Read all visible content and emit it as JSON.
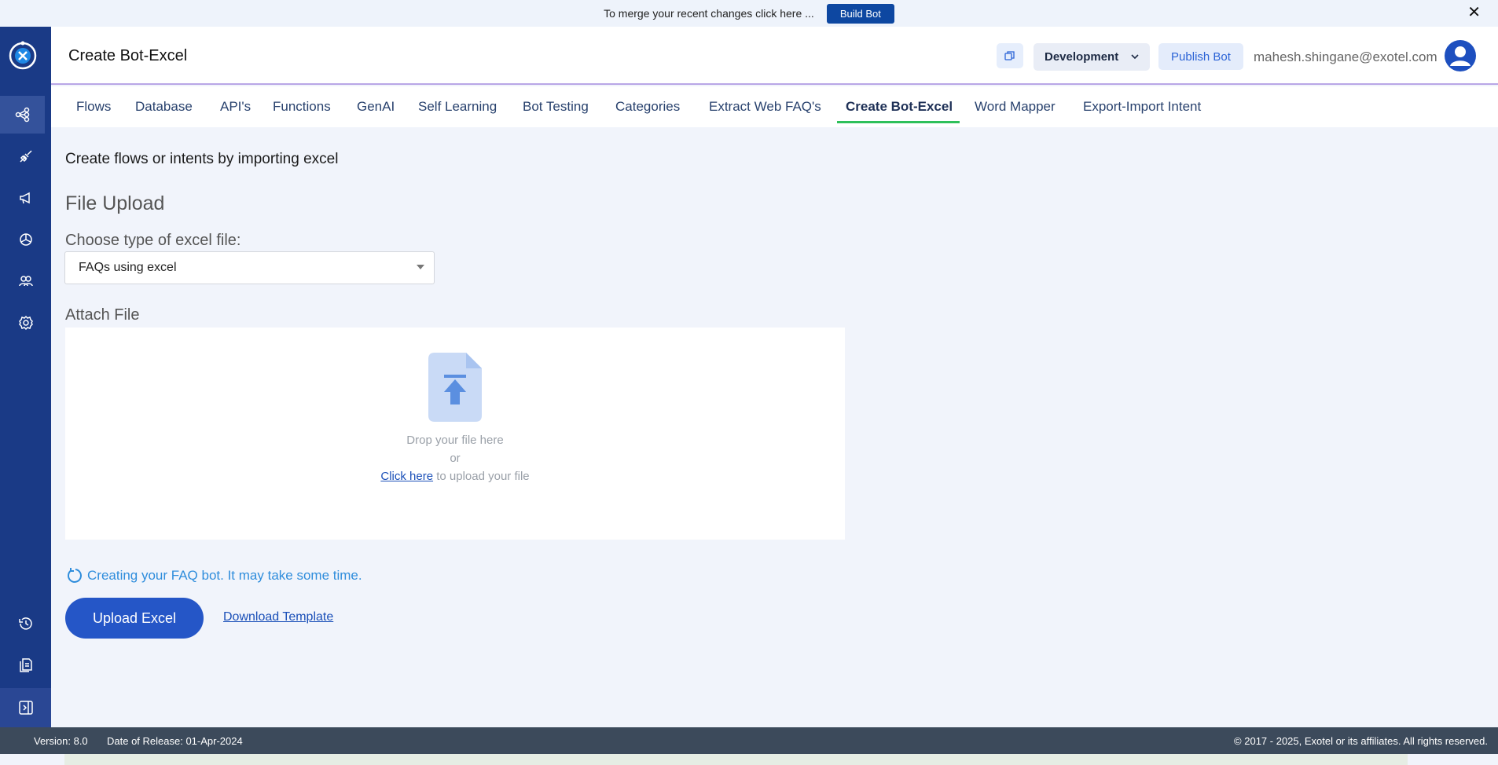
{
  "banner": {
    "message": "To merge your recent changes click here ...",
    "button_label": "Build Bot",
    "close_glyph": "✕"
  },
  "sidebar": {
    "items": [
      {
        "icon": "flows-icon",
        "active": true
      },
      {
        "icon": "integrations-icon"
      },
      {
        "icon": "campaign-icon"
      },
      {
        "icon": "analytics-icon"
      },
      {
        "icon": "users-icon"
      },
      {
        "icon": "settings-icon"
      },
      {
        "icon": "history-icon"
      },
      {
        "icon": "documents-icon"
      },
      {
        "icon": "collapse-sidebar-icon"
      }
    ]
  },
  "header": {
    "title": "Create Bot-Excel",
    "environment": "Development",
    "publish_label": "Publish Bot",
    "user_email": "mahesh.shingane@exotel.com"
  },
  "tabs": [
    {
      "label": "Flows"
    },
    {
      "label": "Database"
    },
    {
      "label": "API's"
    },
    {
      "label": "Functions"
    },
    {
      "label": "GenAI"
    },
    {
      "label": "Self Learning"
    },
    {
      "label": "Bot Testing"
    },
    {
      "label": "Categories"
    },
    {
      "label": "Extract Web FAQ's"
    },
    {
      "label": "Create Bot-Excel",
      "active": true
    },
    {
      "label": "Word Mapper"
    },
    {
      "label": "Export-Import Intent"
    }
  ],
  "main": {
    "subtitle": "Create flows or intents by importing excel",
    "section_title": "File Upload",
    "file_type_label": "Choose type of excel file:",
    "file_type_value": "FAQs using excel",
    "attach_label": "Attach File",
    "dropzone": {
      "line1": "Drop your file here",
      "line2": "or",
      "link": "Click here",
      "line3_rest": " to upload your file"
    },
    "status_text": "Creating your FAQ bot. It may take some time.",
    "upload_button": "Upload Excel",
    "download_link": "Download Template"
  },
  "footer": {
    "version": "Version: 8.0",
    "release": "Date of Release: 01-Apr-2024",
    "copyright": "© 2017 - 2025, Exotel or its affiliates. All rights reserved."
  },
  "colors": {
    "sidebar_bg": "#1a3a86",
    "primary": "#2556c7",
    "active_tab_underline": "#2ec05a",
    "status_text": "#2f8ddc"
  }
}
